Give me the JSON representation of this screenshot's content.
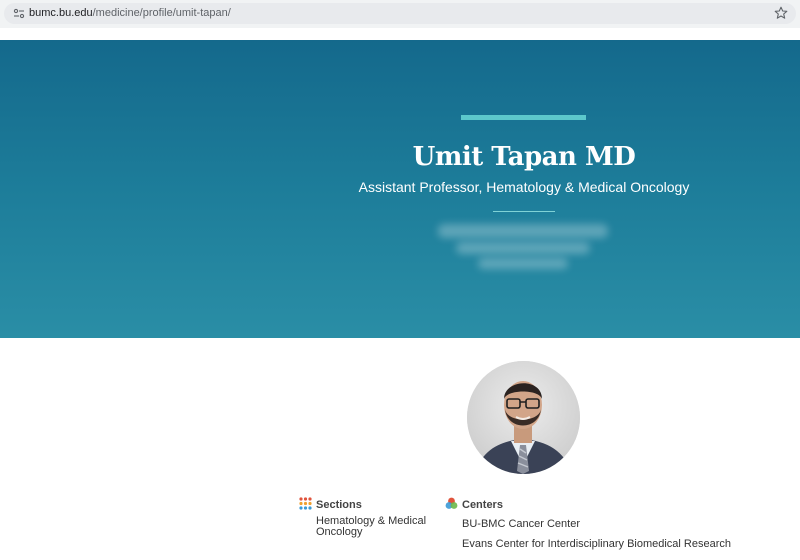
{
  "browser": {
    "url_host": "bumc.bu.edu",
    "url_path": "/medicine/profile/umit-tapan/"
  },
  "hero": {
    "name": "Umit Tapan MD",
    "title": "Assistant Professor, Hematology & Medical Oncology"
  },
  "sections": {
    "heading": "Sections",
    "items": [
      "Hematology & Medical",
      "Oncology"
    ]
  },
  "centers": {
    "heading": "Centers",
    "items": [
      "BU-BMC Cancer Center",
      "Evans Center for Interdisciplinary Biomedical Research"
    ]
  },
  "colors": {
    "hero_top": "#14698c",
    "hero_bottom": "#2a8ea6",
    "accent_rule": "#5cc8cc"
  }
}
